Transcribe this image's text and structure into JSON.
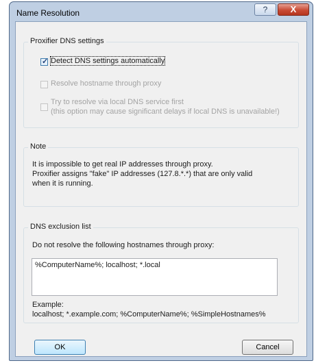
{
  "window": {
    "title": "Name Resolution"
  },
  "titlebar": {
    "help_label": "?",
    "close_label": "X"
  },
  "dns_settings": {
    "legend": "Proxifier DNS settings",
    "detect_auto": {
      "label": "Detect DNS settings automatically",
      "checked": true,
      "enabled": true
    },
    "resolve_proxy": {
      "label": "Resolve hostname through proxy",
      "checked": false,
      "enabled": false
    },
    "local_first": {
      "label_line1": "Try to resolve via local DNS service first",
      "label_line2": "(this option may cause significant delays if local DNS is unavailable!)",
      "checked": false,
      "enabled": false
    }
  },
  "note": {
    "legend": "Note",
    "line1": "It is impossible to get real IP addresses through proxy.",
    "line2": "Proxifier assigns \"fake\" IP addresses (127.8.*.*) that are only valid",
    "line3": "when it is running."
  },
  "exclusion": {
    "legend": "DNS exclusion list",
    "instruction": "Do not resolve the following hostnames through proxy:",
    "value": "%ComputerName%; localhost; *.local",
    "example_label": "Example:",
    "example_text": "localhost; *.example.com; %ComputerName%; %SimpleHostnames%"
  },
  "buttons": {
    "ok": "OK",
    "cancel": "Cancel"
  }
}
